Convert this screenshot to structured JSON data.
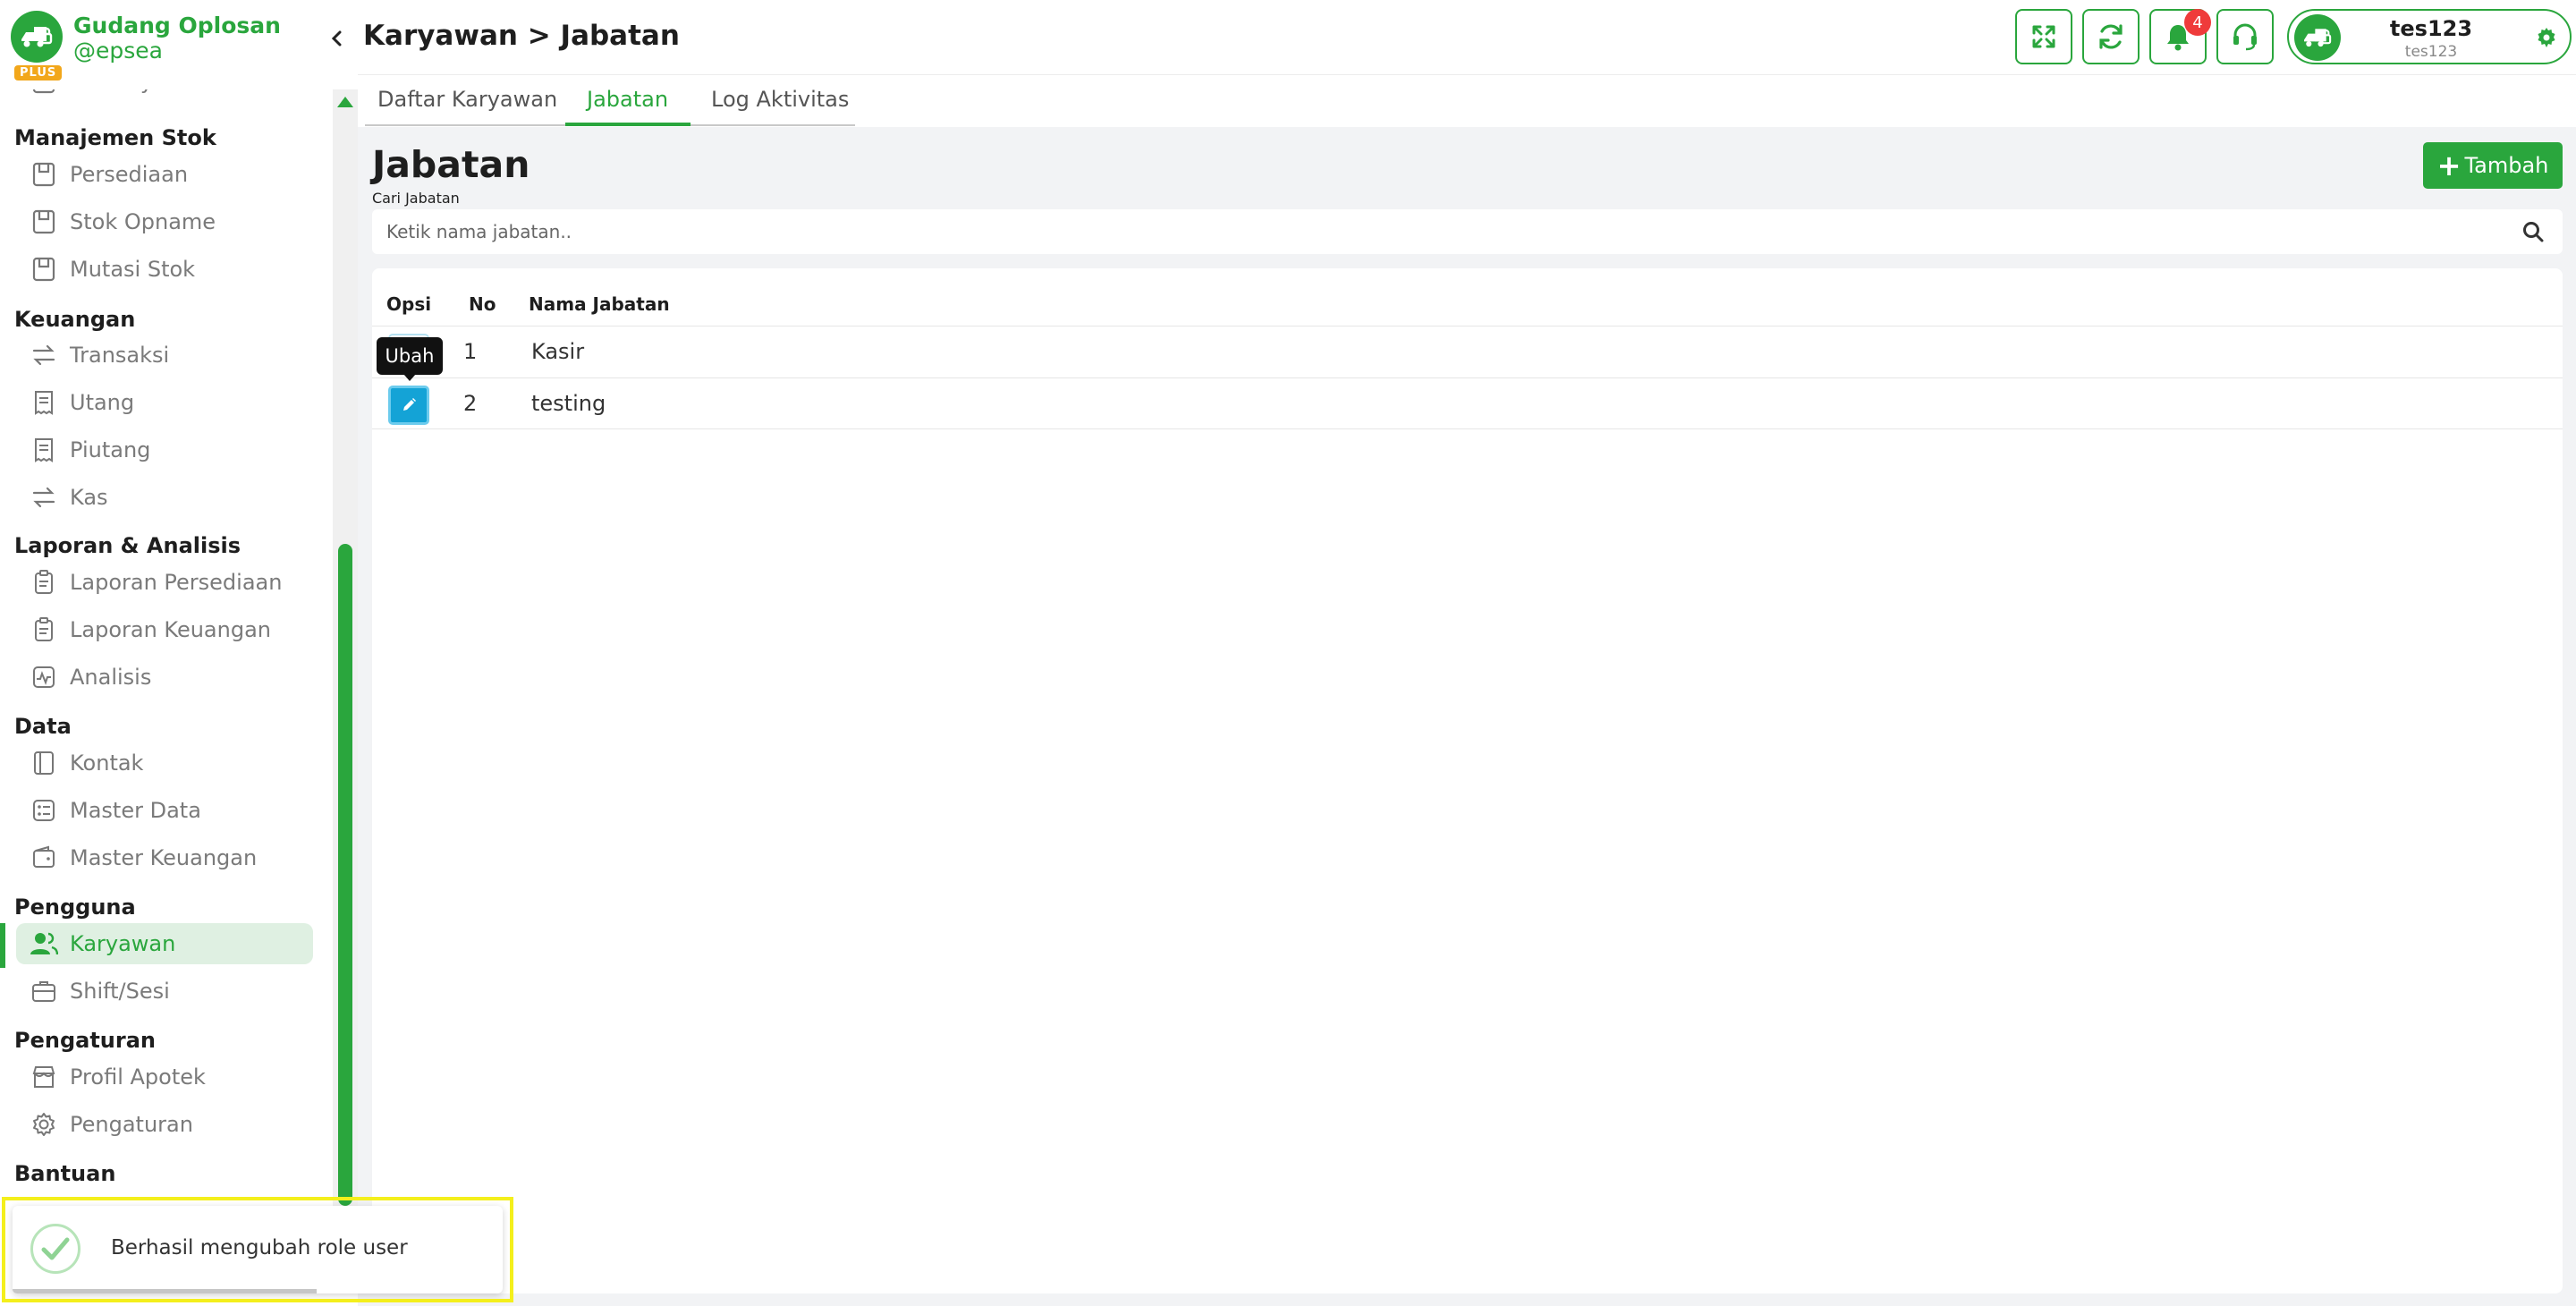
{
  "brand": {
    "name": "Gudang Oplosan",
    "handle": "@epsea",
    "badge": "PLUS"
  },
  "sidebar": {
    "partial_item": "Konsinyasi",
    "sections": [
      {
        "title": "Manajemen Stok",
        "items": [
          {
            "label": "Persediaan",
            "icon": "box-icon"
          },
          {
            "label": "Stok Opname",
            "icon": "box-icon"
          },
          {
            "label": "Mutasi Stok",
            "icon": "box-icon"
          }
        ]
      },
      {
        "title": "Keuangan",
        "items": [
          {
            "label": "Transaksi",
            "icon": "exchange-icon"
          },
          {
            "label": "Utang",
            "icon": "receipt-icon"
          },
          {
            "label": "Piutang",
            "icon": "receipt-icon"
          },
          {
            "label": "Kas",
            "icon": "exchange-icon"
          }
        ]
      },
      {
        "title": "Laporan & Analisis",
        "items": [
          {
            "label": "Laporan Persediaan",
            "icon": "clipboard-icon"
          },
          {
            "label": "Laporan Keuangan",
            "icon": "clipboard-icon"
          },
          {
            "label": "Analisis",
            "icon": "pulse-icon"
          }
        ]
      },
      {
        "title": "Data",
        "items": [
          {
            "label": "Kontak",
            "icon": "book-icon"
          },
          {
            "label": "Master Data",
            "icon": "list-icon"
          },
          {
            "label": "Master Keuangan",
            "icon": "wallet-icon"
          }
        ]
      },
      {
        "title": "Pengguna",
        "items": [
          {
            "label": "Karyawan",
            "icon": "users-icon",
            "active": true
          },
          {
            "label": "Shift/Sesi",
            "icon": "briefcase-icon"
          }
        ]
      },
      {
        "title": "Pengaturan",
        "items": [
          {
            "label": "Profil Apotek",
            "icon": "store-icon"
          },
          {
            "label": "Pengaturan",
            "icon": "gear-icon"
          }
        ]
      },
      {
        "title": "Bantuan",
        "items": []
      }
    ]
  },
  "header": {
    "breadcrumb": "Karyawan > Jabatan",
    "notification_count": "4",
    "user_name": "tes123",
    "user_sub": "tes123",
    "icons": [
      "fullscreen-icon",
      "refresh-icon",
      "bell-icon",
      "headset-icon",
      "gear-icon"
    ]
  },
  "tabs": [
    {
      "label": "Daftar Karyawan",
      "active": false
    },
    {
      "label": "Jabatan",
      "active": true
    },
    {
      "label": "Log Aktivitas",
      "active": false
    }
  ],
  "main": {
    "title": "Jabatan",
    "add_label": "Tambah",
    "search_label": "Cari Jabatan",
    "search_placeholder": "Ketik nama jabatan..",
    "search_value": ""
  },
  "table": {
    "columns": [
      "Opsi",
      "No",
      "Nama Jabatan"
    ],
    "rows": [
      {
        "no": "1",
        "name": "Kasir"
      },
      {
        "no": "2",
        "name": "testing"
      }
    ]
  },
  "tooltip": "Ubah",
  "toast": {
    "message": "Berhasil mengubah role user",
    "type": "success"
  },
  "colors": {
    "accent": "#2aa63d",
    "edit_button": "#14a3d6",
    "badge": "#ef3b3b",
    "toast_highlight": "#f4ef1c"
  }
}
